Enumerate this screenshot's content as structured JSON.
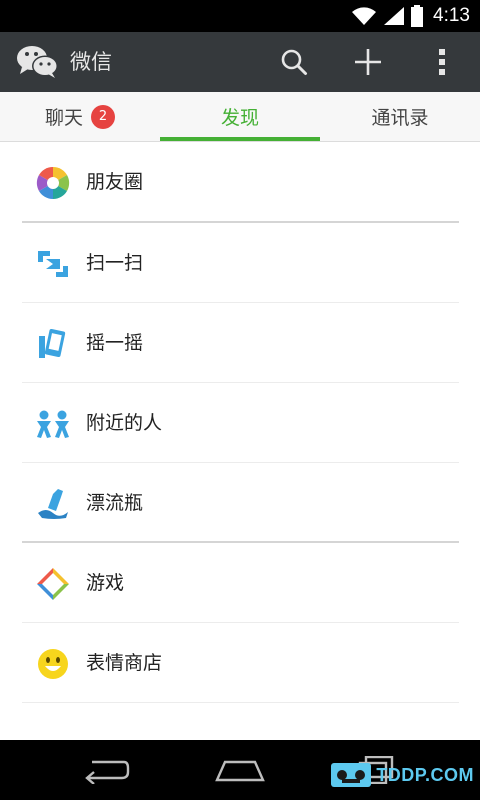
{
  "status_bar": {
    "time": "4:13",
    "icons": [
      "wifi-icon",
      "signal-icon",
      "battery-icon"
    ]
  },
  "app_bar": {
    "title": "微信",
    "logo_icon": "wechat-logo-icon",
    "actions": [
      "search-icon",
      "add-icon",
      "more-vertical-icon"
    ]
  },
  "tabs": [
    {
      "label": "聊天",
      "badge": "2",
      "active": false
    },
    {
      "label": "发现",
      "badge": "",
      "active": true
    },
    {
      "label": "通讯录",
      "badge": "",
      "active": false
    }
  ],
  "discover_items": [
    {
      "label": "朋友圈",
      "icon": "moments-icon"
    },
    {
      "label": "扫一扫",
      "icon": "scan-icon"
    },
    {
      "label": "摇一摇",
      "icon": "shake-icon"
    },
    {
      "label": "附近的人",
      "icon": "people-nearby-icon"
    },
    {
      "label": "漂流瓶",
      "icon": "drift-bottle-icon"
    },
    {
      "label": "游戏",
      "icon": "games-icon"
    },
    {
      "label": "表情商店",
      "icon": "sticker-store-icon"
    }
  ],
  "nav_bar": {
    "buttons": [
      "back-icon",
      "home-icon",
      "recent-apps-icon"
    ]
  },
  "watermark": {
    "text": "TDDP.COM"
  },
  "colors": {
    "accent": "#45b035",
    "appbar": "#35393c",
    "badge": "#e64340"
  }
}
